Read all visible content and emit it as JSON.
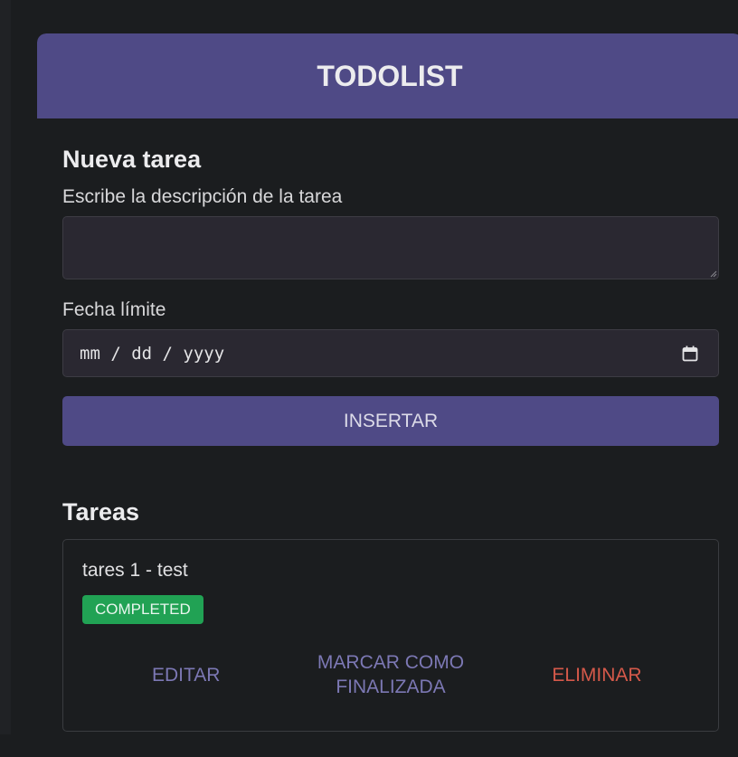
{
  "header": {
    "title": "TODOLIST"
  },
  "new_task": {
    "section_title": "Nueva tarea",
    "description_label": "Escribe la descripción de la tarea",
    "description_value": "",
    "deadline_label": "Fecha límite",
    "deadline_placeholder": "mm / dd / yyyy",
    "insert_button_label": "INSERTAR"
  },
  "tasks": {
    "section_title": "Tareas",
    "items": [
      {
        "description": "tares 1 - test",
        "status": "COMPLETED",
        "actions": {
          "edit": "EDITAR",
          "mark_done_line1": "MARCAR COMO",
          "mark_done_line2": "FINALIZADA",
          "delete": "ELIMINAR"
        }
      }
    ]
  },
  "colors": {
    "background": "#1b1d1f",
    "header": "#4f4a86",
    "accent_text": "#7c78b4",
    "success": "#21a254",
    "danger": "#d5594a"
  },
  "icons": {
    "date_picker": "calendar-icon"
  }
}
